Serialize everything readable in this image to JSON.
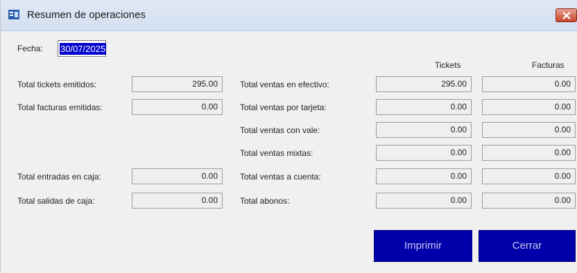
{
  "window": {
    "title": "Resumen de operaciones"
  },
  "fecha": {
    "label": "Fecha:",
    "value": "30/07/2025"
  },
  "columns": {
    "tickets": "Tickets",
    "facturas": "Facturas"
  },
  "left": [
    {
      "label": "Total tickets emitidos:",
      "value": "295.00"
    },
    {
      "label": "Total facturas emitidas:",
      "value": "0.00"
    },
    {
      "label": "Total entradas en caja:",
      "value": "0.00"
    },
    {
      "label": "Total salidas de caja:",
      "value": "0.00"
    }
  ],
  "right": [
    {
      "label": "Total ventas en efectivo:",
      "tickets": "295.00",
      "facturas": "0.00"
    },
    {
      "label": "Total ventas por tarjeta:",
      "tickets": "0.00",
      "facturas": "0.00"
    },
    {
      "label": "Total ventas con vale:",
      "tickets": "0.00",
      "facturas": "0.00"
    },
    {
      "label": "Total ventas mixtas:",
      "tickets": "0.00",
      "facturas": "0.00"
    },
    {
      "label": "Total ventas a cuenta:",
      "tickets": "0.00",
      "facturas": "0.00"
    },
    {
      "label": "Total abonos:",
      "tickets": "0.00",
      "facturas": "0.00"
    }
  ],
  "buttons": {
    "print": "Imprimir",
    "close": "Cerrar"
  },
  "colors": {
    "button_bg": "#0000aa",
    "selection_bg": "#0000cc",
    "close_button": "#c7462c"
  }
}
